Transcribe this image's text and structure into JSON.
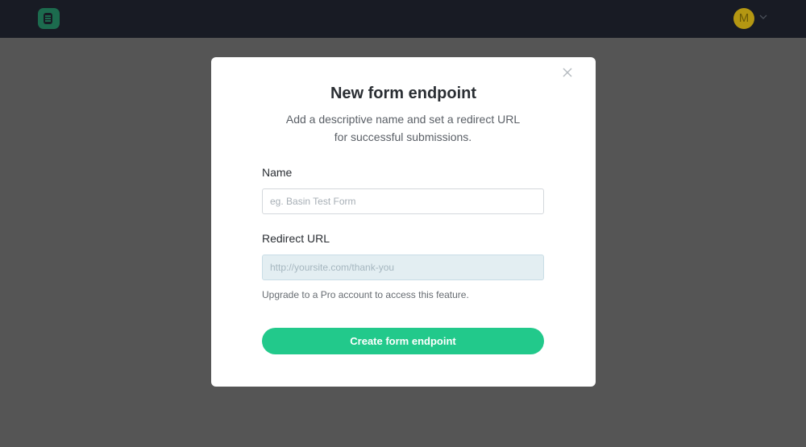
{
  "topbar": {
    "logo_icon": "basin-logo-icon",
    "avatar_initial": "M",
    "avatar_color": "#b49712",
    "avatar_menu_icon": "chevron-down-icon",
    "background": "#181b24"
  },
  "modal": {
    "close_icon": "close-icon",
    "title": "New form endpoint",
    "subtitle": "Add a descriptive name and set a redirect URL for successful submissions.",
    "name_field": {
      "label": "Name",
      "value": "",
      "placeholder": "eg. Basin Test Form"
    },
    "redirect_field": {
      "label": "Redirect URL",
      "value": "",
      "placeholder": "http://yoursite.com/thank-you",
      "disabled": true
    },
    "help_text": "Upgrade to a Pro account to access this feature.",
    "submit_label": "Create form endpoint",
    "accent_color": "#22c98b"
  }
}
